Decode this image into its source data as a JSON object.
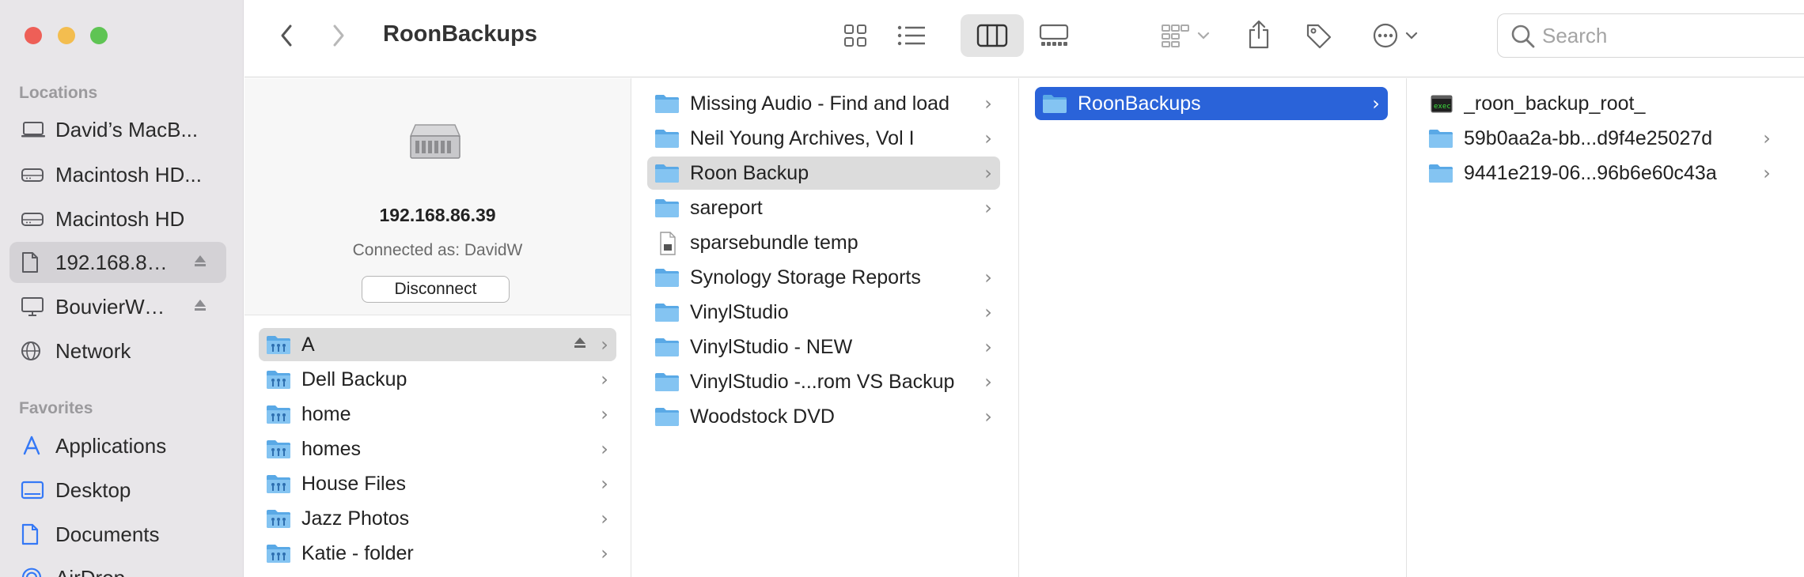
{
  "window": {
    "title": "RoonBackups"
  },
  "toolbar": {
    "search_placeholder": "Search"
  },
  "sidebar": {
    "locations_header": "Locations",
    "locations": [
      {
        "label": "David’s MacB...",
        "icon": "laptop-icon"
      },
      {
        "label": "Macintosh HD...",
        "icon": "drive-icon"
      },
      {
        "label": "Macintosh HD",
        "icon": "drive-icon"
      },
      {
        "label": "192.168.86...",
        "icon": "server-doc-icon",
        "selected": true,
        "eject": true
      },
      {
        "label": "BouvierWei...",
        "icon": "display-icon",
        "eject": true
      },
      {
        "label": "Network",
        "icon": "globe-icon"
      }
    ],
    "favorites_header": "Favorites",
    "favorites": [
      {
        "label": "Applications",
        "icon": "applications-icon"
      },
      {
        "label": "Desktop",
        "icon": "desktop-icon"
      },
      {
        "label": "Documents",
        "icon": "document-icon"
      },
      {
        "label": "AirDrop",
        "icon": "airdrop-icon"
      }
    ]
  },
  "server_preview": {
    "ip": "192.168.86.39",
    "connected_as": "Connected as: DavidW",
    "disconnect_label": "Disconnect"
  },
  "column1": {
    "items": [
      {
        "name": "A",
        "selected": true,
        "eject": true
      },
      {
        "name": "Dell Backup"
      },
      {
        "name": "home"
      },
      {
        "name": "homes"
      },
      {
        "name": "House Files"
      },
      {
        "name": "Jazz Photos"
      },
      {
        "name": "Katie - folder"
      }
    ]
  },
  "column2": {
    "items": [
      {
        "name": "Missing Audio - Find and load",
        "type": "folder"
      },
      {
        "name": "Neil Young Archives, Vol I",
        "type": "folder"
      },
      {
        "name": "Roon Backup",
        "type": "folder",
        "selected": true
      },
      {
        "name": "sareport",
        "type": "folder"
      },
      {
        "name": "sparsebundle temp",
        "type": "file"
      },
      {
        "name": "Synology Storage Reports",
        "type": "folder"
      },
      {
        "name": "VinylStudio",
        "type": "folder"
      },
      {
        "name": "VinylStudio - NEW",
        "type": "folder"
      },
      {
        "name": "VinylStudio -...rom VS Backup",
        "type": "folder"
      },
      {
        "name": "Woodstock DVD",
        "type": "folder"
      }
    ]
  },
  "column3": {
    "items": [
      {
        "name": "RoonBackups",
        "type": "folder",
        "selected": true
      }
    ]
  },
  "column4": {
    "items": [
      {
        "name": "_roon_backup_root_",
        "type": "exec"
      },
      {
        "name": "59b0aa2a-bb...d9f4e25027d",
        "type": "folder"
      },
      {
        "name": "9441e219-06...96b6e60c43a",
        "type": "folder"
      }
    ]
  },
  "colors": {
    "selection_blue": "#2a63d9",
    "folder_blue": "#6cb6ee",
    "sidebar_bg": "#e8e6e9",
    "accent": "#3478f6"
  }
}
